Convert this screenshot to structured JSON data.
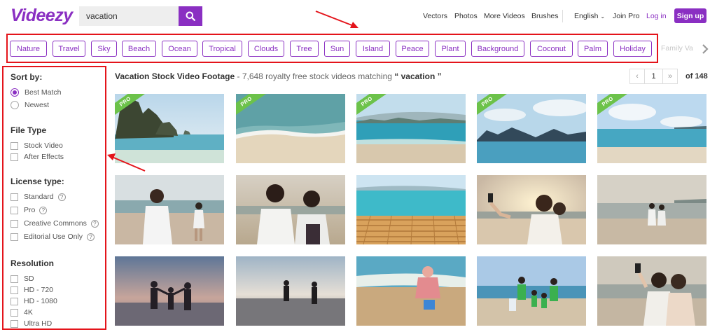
{
  "header": {
    "logo": "Videezy",
    "search_value": "vacation",
    "nav": [
      "Vectors",
      "Photos",
      "More Videos",
      "Brushes"
    ],
    "language": "English",
    "join_pro": "Join Pro",
    "login": "Log in",
    "signup": "Sign up",
    "accent_color": "#8a2fc2"
  },
  "tags": [
    "Nature",
    "Travel",
    "Sky",
    "Beach",
    "Ocean",
    "Tropical",
    "Clouds",
    "Tree",
    "Sun",
    "Island",
    "Peace",
    "Plant",
    "Background",
    "Coconut",
    "Palm",
    "Holiday"
  ],
  "tag_faded": "Family Va",
  "sidebar": {
    "sort_label": "Sort by:",
    "sort_options": [
      "Best Match",
      "Newest"
    ],
    "filetype_label": "File Type",
    "filetype_options": [
      "Stock Video",
      "After Effects"
    ],
    "license_label": "License type:",
    "license_options": [
      "Standard",
      "Pro",
      "Creative Commons",
      "Editorial Use Only"
    ],
    "resolution_label": "Resolution",
    "resolution_options": [
      "SD",
      "HD - 720",
      "HD - 1080",
      "4K",
      "Ultra HD"
    ]
  },
  "results": {
    "title": "Vacation Stock Video Footage",
    "subtitle": " - 7,648 royalty free stock videos matching",
    "query_quoted": " “ vacation ”",
    "page": "1",
    "of_pages": "of 148",
    "prev": "‹",
    "next": "»"
  },
  "thumbnails": [
    {
      "name": "island-rocks",
      "pro": true
    },
    {
      "name": "beach-waves",
      "pro": true
    },
    {
      "name": "shore-mountains",
      "pro": true
    },
    {
      "name": "bay-islands",
      "pro": true
    },
    {
      "name": "sunny-beach",
      "pro": true
    },
    {
      "name": "woman-beach-walk",
      "pro": false
    },
    {
      "name": "two-women-sunset",
      "pro": false
    },
    {
      "name": "wooden-pier",
      "pro": false
    },
    {
      "name": "selfie-sunset",
      "pro": false
    },
    {
      "name": "friends-beach-sunset",
      "pro": false
    },
    {
      "name": "family-silhouette",
      "pro": false
    },
    {
      "name": "beach-play-silhouette",
      "pro": false
    },
    {
      "name": "child-sandcastle",
      "pro": false
    },
    {
      "name": "family-cleanup",
      "pro": false
    },
    {
      "name": "women-selfie-beach",
      "pro": false
    }
  ],
  "pro_label": "PRO",
  "annotation_color": "#e4141b"
}
